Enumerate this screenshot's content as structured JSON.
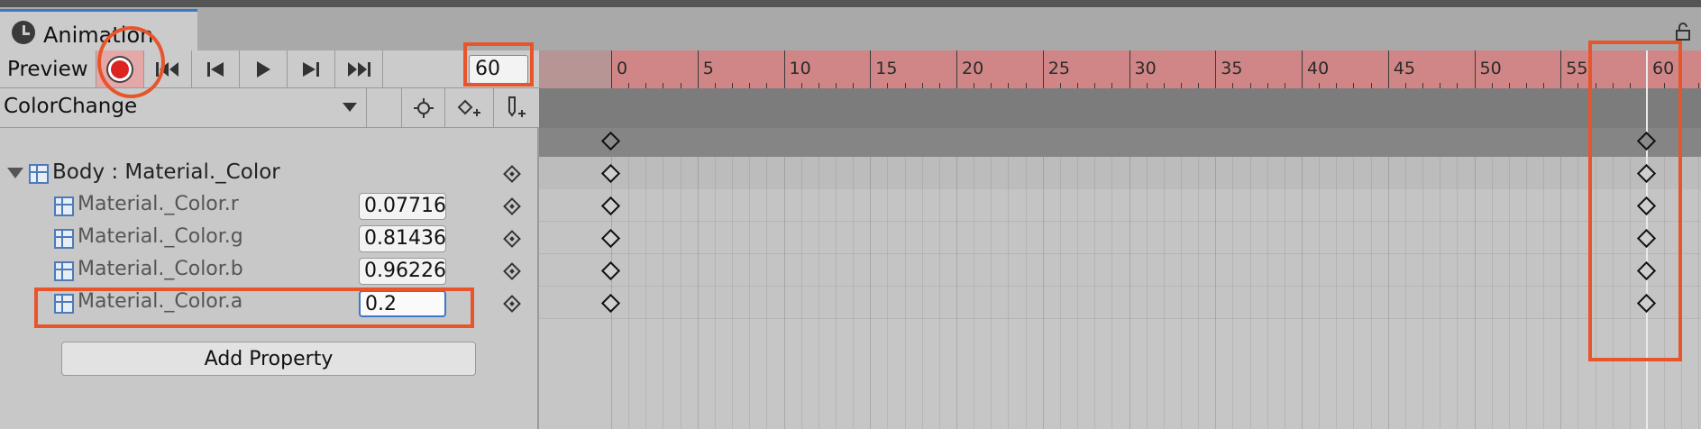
{
  "window": {
    "tab_title": "Animation"
  },
  "toolbar": {
    "preview_label": "Preview",
    "frame_value": "60",
    "buttons": [
      "record-button",
      "first-key-button",
      "prev-key-button",
      "play-button",
      "next-key-button",
      "last-key-button"
    ]
  },
  "clip": {
    "name": "ColorChange"
  },
  "properties": {
    "group_label": "Body : Material._Color",
    "items": [
      {
        "label": "Material._Color.r",
        "value": "0.07716"
      },
      {
        "label": "Material._Color.g",
        "value": "0.81436"
      },
      {
        "label": "Material._Color.b",
        "value": "0.96226"
      },
      {
        "label": "Material._Color.a",
        "value": "0.2"
      }
    ],
    "add_label": "Add Property"
  },
  "timeline": {
    "ticks": [
      "0",
      "5",
      "10",
      "15",
      "20",
      "25",
      "30",
      "35",
      "40",
      "45",
      "50",
      "55",
      "60"
    ],
    "keyframe_frames": [
      0,
      60
    ]
  },
  "colors": {
    "record_tint": "#e4a8a8",
    "ruler": "#d08686",
    "annotation": "#e8552b",
    "selection": "#3a79c7"
  }
}
